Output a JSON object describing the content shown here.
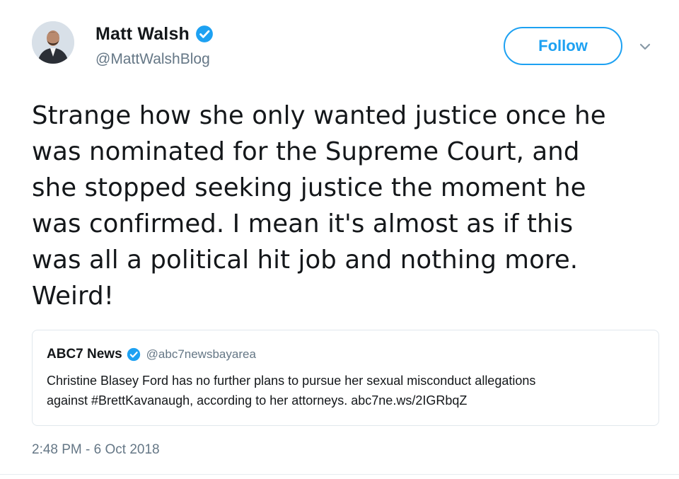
{
  "author": {
    "display_name": "Matt Walsh",
    "handle": "@MattWalshBlog",
    "verified": true,
    "avatar_icon": "profile-photo"
  },
  "actions": {
    "follow_label": "Follow",
    "more_icon": "chevron-down-icon"
  },
  "tweet": {
    "lines": [
      "Strange how she only wanted justice once he",
      "was nominated for the Supreme Court, and",
      "she stopped seeking justice the moment he",
      "was confirmed. I mean it's almost as if this",
      "was all a political hit job and nothing more.",
      "Weird!"
    ],
    "timestamp": "2:48 PM - 6 Oct 2018"
  },
  "quoted_tweet": {
    "display_name": "ABC7 News",
    "handle": "@abc7newsbayarea",
    "verified": true,
    "lines": [
      "Christine Blasey Ford has no further plans to pursue her sexual misconduct allegations",
      "against #BrettKavanaugh, according to her attorneys. abc7ne.ws/2IGRbqZ"
    ]
  },
  "colors": {
    "accent": "#1da1f2",
    "text": "#14171a",
    "secondary_text": "#657786",
    "border": "#e1e8ed"
  }
}
